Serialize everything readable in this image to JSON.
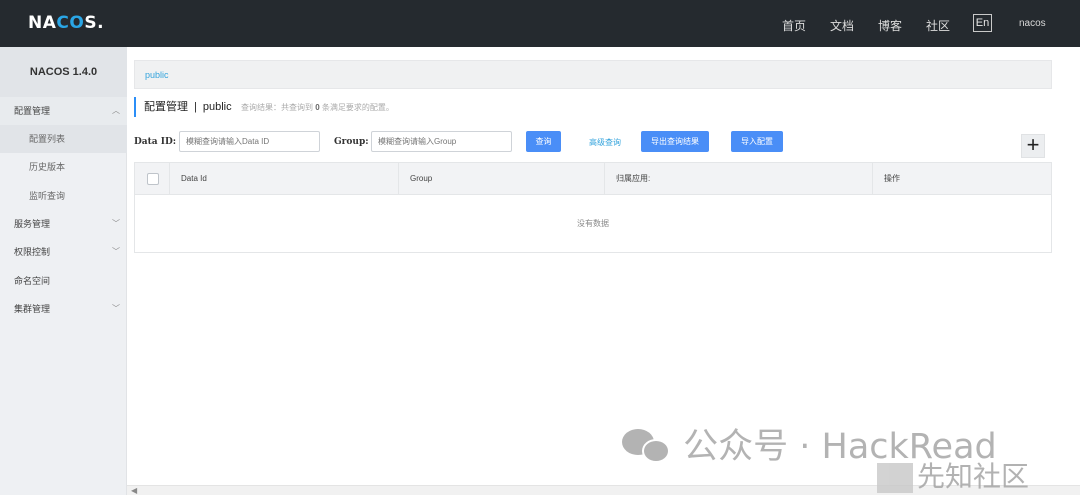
{
  "header": {
    "logo": {
      "left": "NA",
      "mid": "CO",
      "right": "S."
    },
    "nav": [
      "首页",
      "文档",
      "博客",
      "社区"
    ],
    "lang": "En",
    "user": "nacos"
  },
  "sidebar": {
    "title": "NACOS 1.4.0",
    "items": [
      {
        "label": "配置管理",
        "type": "group",
        "open": true
      },
      {
        "label": "配置列表",
        "type": "sub",
        "active": true
      },
      {
        "label": "历史版本",
        "type": "sub"
      },
      {
        "label": "监听查询",
        "type": "sub"
      },
      {
        "label": "服务管理",
        "type": "group"
      },
      {
        "label": "权限控制",
        "type": "group"
      },
      {
        "label": "命名空间",
        "type": "group"
      },
      {
        "label": "集群管理",
        "type": "group"
      }
    ]
  },
  "main": {
    "namespace": "public",
    "title": "配置管理",
    "title_sep": "|",
    "title_ns": "public",
    "result": {
      "prefix": "查询结果：共查询到",
      "count": "0",
      "suffix": "条满足要求的配置。"
    },
    "search": {
      "dataid_label": "Data ID:",
      "dataid_placeholder": "模糊查询请输入Data ID",
      "group_label": "Group:",
      "group_placeholder": "模糊查询请输入Group",
      "query_button": "查询",
      "advanced_link": "高级查询",
      "export_button": "导出查询结果",
      "import_button": "导入配置",
      "add_button": "+"
    },
    "table": {
      "columns": [
        "Data Id",
        "Group",
        "归属应用:",
        "操作"
      ],
      "empty_text": "没有数据"
    }
  },
  "watermark": {
    "primary": "公众号 · HackRead",
    "secondary": "先知社区"
  }
}
